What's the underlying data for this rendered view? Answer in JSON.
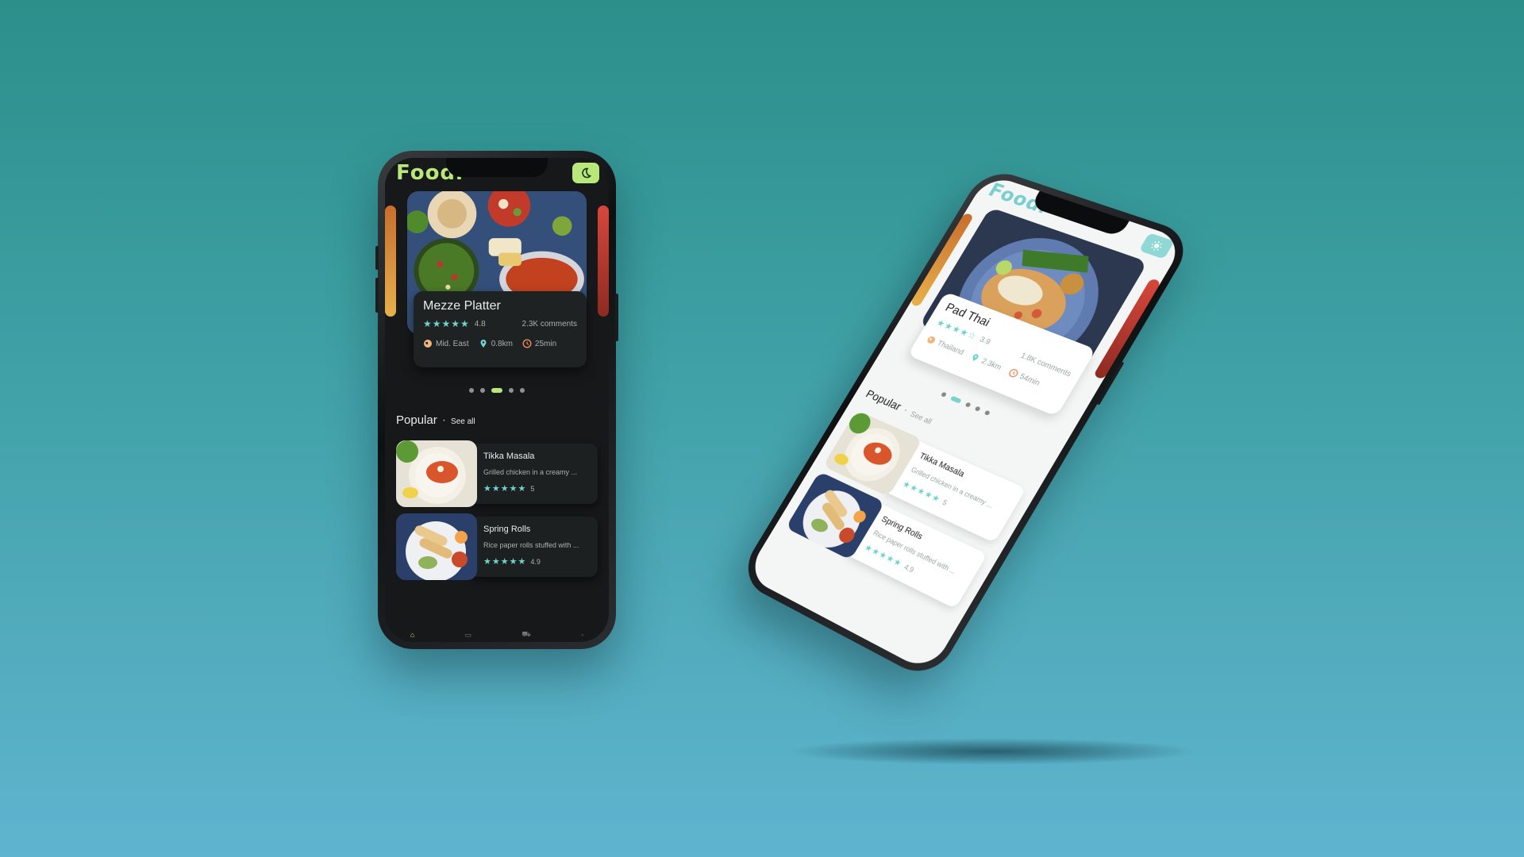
{
  "brand": {
    "logo": "Foodi"
  },
  "theme_icons": {
    "dark_toggle": "moon-icon",
    "light_toggle": "sun-icon"
  },
  "colors": {
    "accent_dark": "#b9e77a",
    "accent_light": "#7bd3d0",
    "star": "#6fd3cd",
    "location": "#6fd3cd",
    "cuisine": "#f0b47a",
    "time": "#f08a5d"
  },
  "dark_phone": {
    "featured": {
      "title": "Mezze Platter",
      "stars": "★★★★★",
      "rating": "4.8",
      "comments": "2.3K comments",
      "cuisine": "Mid. East",
      "distance": "0.8km",
      "time": "25min"
    },
    "carousel": {
      "count": 5,
      "active_index": 2
    },
    "popular": {
      "title": "Popular",
      "see_all": "See all",
      "items": [
        {
          "name": "Tikka Masala",
          "description": "Grilled chicken in a creamy ...",
          "stars": "★★★★★",
          "rating": "5"
        },
        {
          "name": "Spring Rolls",
          "description": "Rice paper rolls stuffed with ...",
          "stars": "★★★★★",
          "rating": "4.9"
        }
      ]
    },
    "nav": {
      "items": [
        "home-icon",
        "bookmark-icon",
        "cart-icon",
        "profile-icon"
      ],
      "active_index": 0
    }
  },
  "light_phone": {
    "featured": {
      "title": "Pad Thai",
      "stars": "★★★★☆",
      "rating": "3.9",
      "comments": "1.8K comments",
      "cuisine": "Thailand",
      "distance": "2.3km",
      "time": "54min"
    },
    "carousel": {
      "count": 5,
      "active_index": 1
    },
    "popular": {
      "title": "Popular",
      "see_all": "See all",
      "items": [
        {
          "name": "Tikka Masala",
          "description": "Grilled chicken in a creamy ...",
          "stars": "★★★★★",
          "rating": "5"
        },
        {
          "name": "Spring Rolls",
          "description": "Rice paper rolls stuffed with ...",
          "stars": "★★★★★",
          "rating": "4.9"
        }
      ]
    }
  }
}
